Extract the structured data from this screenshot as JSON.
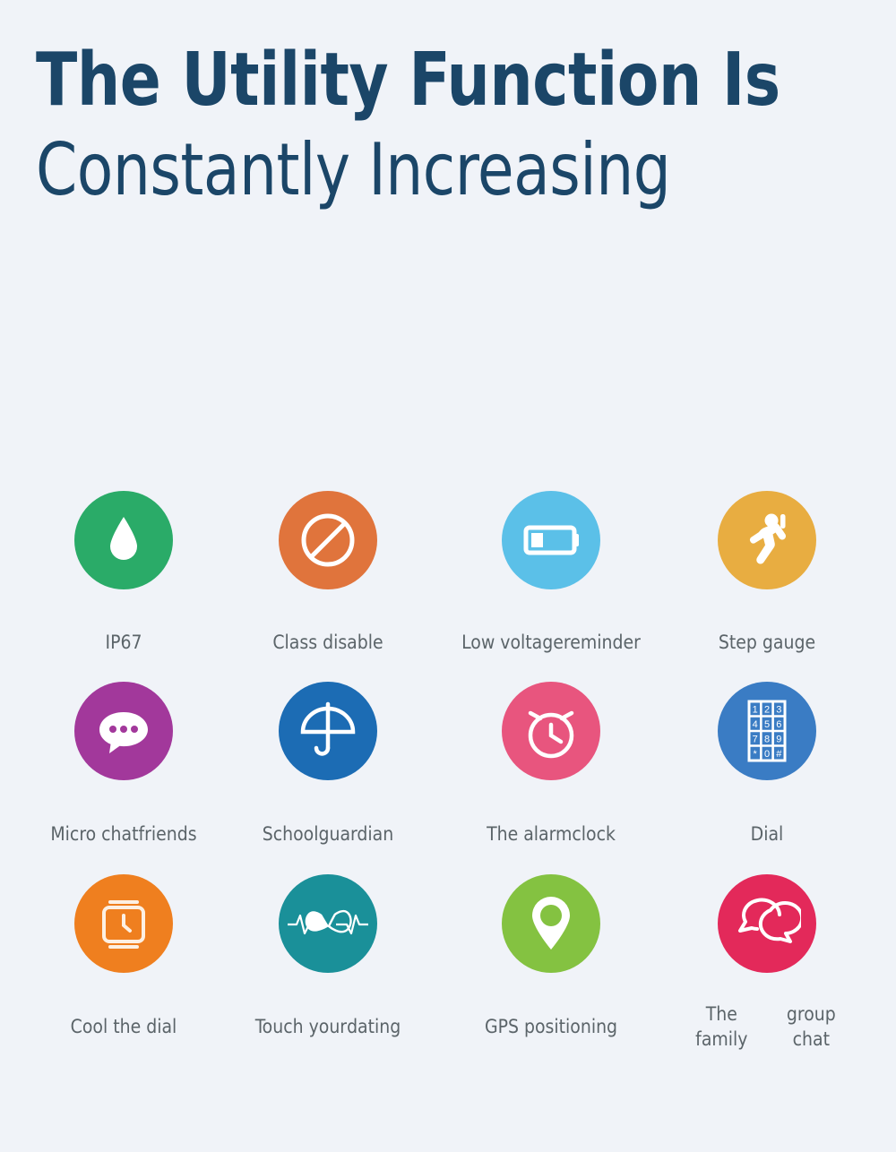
{
  "page": {
    "background_color": "#f0f3f8",
    "heading_color": "#1b4668",
    "label_color": "#5b6469"
  },
  "heading": {
    "line1": "The Utility Function Is",
    "line2": "Constantly Increasing"
  },
  "features": [
    {
      "label": "IP67",
      "label_lines": [
        "IP67"
      ],
      "icon": "water-drop-icon",
      "color": "#2aab68"
    },
    {
      "label": "Class disable",
      "label_lines": [
        "Class disable"
      ],
      "icon": "prohibited-sign-icon",
      "color": "#e0743c"
    },
    {
      "label": "Low voltage reminder",
      "label_lines": [
        "Low voltage",
        "reminder"
      ],
      "icon": "low-battery-icon",
      "color": "#5bc0e8"
    },
    {
      "label": "Step gauge",
      "label_lines": [
        "Step gauge"
      ],
      "icon": "running-person-icon",
      "color": "#e8ad41"
    },
    {
      "label": "Micro chat friends",
      "label_lines": [
        "Micro chat",
        "friends"
      ],
      "icon": "chat-bubble-dots-icon",
      "color": "#a2389b"
    },
    {
      "label": "School guardian",
      "label_lines": [
        "School",
        "guardian"
      ],
      "icon": "umbrella-icon",
      "color": "#1c6cb4"
    },
    {
      "label": "The alarm clock",
      "label_lines": [
        "The alarm",
        "clock"
      ],
      "icon": "alarm-clock-icon",
      "color": "#e8557e"
    },
    {
      "label": "Dial",
      "label_lines": [
        "Dial"
      ],
      "icon": "dial-keypad-icon",
      "color": "#3a7cc4",
      "keypad_keys": [
        "1",
        "2",
        "3",
        "4",
        "5",
        "6",
        "7",
        "8",
        "9",
        "*",
        "0",
        "#"
      ]
    },
    {
      "label": "Cool the dial",
      "label_lines": [
        "Cool the dial"
      ],
      "icon": "smartwatch-icon",
      "color": "#ef7f1f"
    },
    {
      "label": "Touch your dating",
      "label_lines": [
        "Touch your",
        "dating"
      ],
      "icon": "two-hearts-heartbeat-icon",
      "color": "#1a9099"
    },
    {
      "label": "GPS positioning",
      "label_lines": [
        "GPS positioning"
      ],
      "icon": "map-pin-icon",
      "color": "#84c241"
    },
    {
      "label": "The family group chat",
      "label_lines": [
        "The family",
        "group chat"
      ],
      "icon": "group-chat-bubbles-icon",
      "color": "#e3295a"
    }
  ]
}
